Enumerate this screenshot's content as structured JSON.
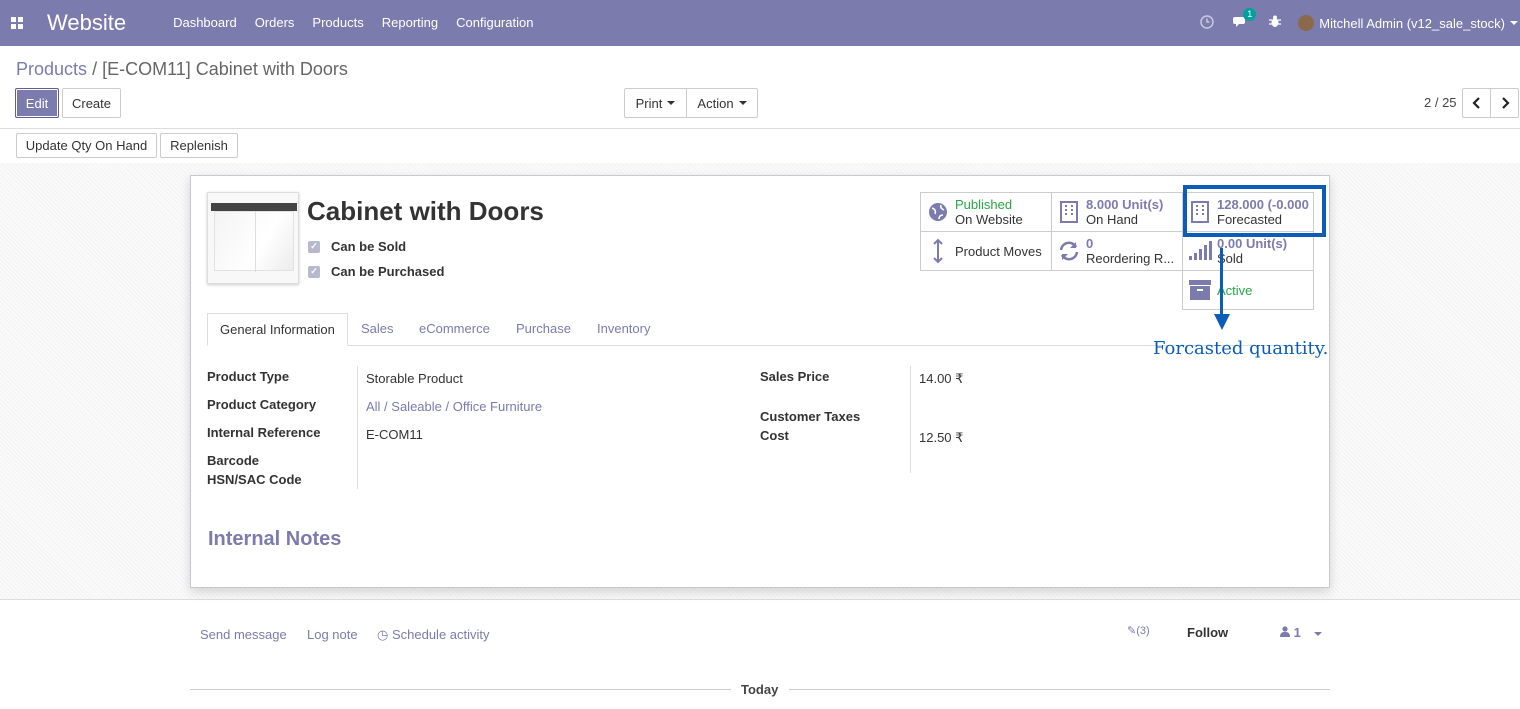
{
  "topbar": {
    "app_title": "Website",
    "menu": [
      "Dashboard",
      "Orders",
      "Products",
      "Reporting",
      "Configuration"
    ],
    "messages_count": "1",
    "user_name": "Mitchell Admin (v12_sale_stock)"
  },
  "breadcrumb": {
    "parent": "Products",
    "separator": "/",
    "current": "[E-COM11] Cabinet with Doors"
  },
  "control": {
    "edit_label": "Edit",
    "create_label": "Create",
    "print_label": "Print",
    "action_label": "Action",
    "pager": "2 / 25"
  },
  "header_buttons": {
    "update_qty": "Update Qty On Hand",
    "replenish": "Replenish"
  },
  "product": {
    "name": "Cabinet with Doors",
    "can_be_sold": "Can be Sold",
    "can_be_purchased": "Can be Purchased"
  },
  "stat_buttons": {
    "published": {
      "line1": "Published",
      "line2": "On Website"
    },
    "on_hand": {
      "value": "8.000",
      "unit": "Unit(s)",
      "label": "On Hand"
    },
    "forecasted": {
      "value": "128.000 (-0.000",
      "label": "Forecasted"
    },
    "product_moves": {
      "label": "Product Moves"
    },
    "reordering": {
      "value": "0",
      "label": "Reordering R..."
    },
    "sold": {
      "value": "0.00",
      "unit": "Unit(s)",
      "label": "Sold"
    },
    "active": {
      "label": "Active"
    }
  },
  "annotation": "Forcasted quantity.",
  "tabs": [
    "General Information",
    "Sales",
    "eCommerce",
    "Purchase",
    "Inventory"
  ],
  "general": {
    "product_type_label": "Product Type",
    "product_type": "Storable Product",
    "category_label": "Product Category",
    "category": "All / Saleable / Office Furniture",
    "internal_ref_label": "Internal Reference",
    "internal_ref": "E-COM11",
    "barcode_label": "Barcode",
    "hsn_label": "HSN/SAC Code",
    "sales_price_label": "Sales Price",
    "sales_price": "14.00 ₹",
    "customer_taxes_label": "Customer Taxes",
    "cost_label": "Cost",
    "cost": "12.50 ₹"
  },
  "internal_notes_title": "Internal Notes",
  "chatter": {
    "send_message": "Send message",
    "log_note": "Log note",
    "schedule_activity": "Schedule activity",
    "attachments": "(3)",
    "follow": "Follow",
    "followers": "1",
    "today": "Today"
  },
  "colors": {
    "brand": "#7c7bad",
    "highlight": "#0b5db7",
    "published_green": "#28a745"
  }
}
